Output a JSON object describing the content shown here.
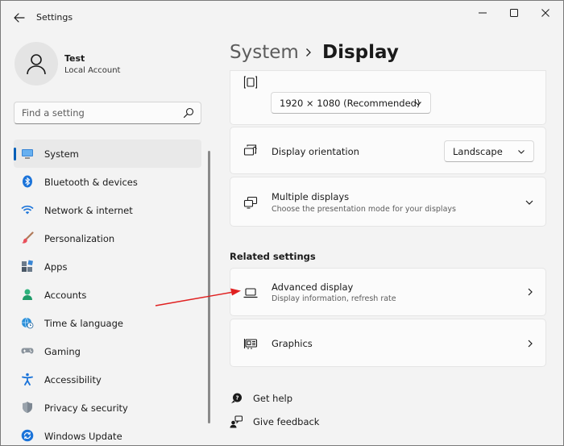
{
  "window": {
    "title": "Settings"
  },
  "user": {
    "name": "Test",
    "account_type": "Local Account"
  },
  "search": {
    "placeholder": "Find a setting"
  },
  "sidebar": {
    "items": [
      {
        "label": "System",
        "icon": "monitor-icon",
        "active": true
      },
      {
        "label": "Bluetooth & devices",
        "icon": "bluetooth-icon"
      },
      {
        "label": "Network & internet",
        "icon": "wifi-icon"
      },
      {
        "label": "Personalization",
        "icon": "brush-icon"
      },
      {
        "label": "Apps",
        "icon": "apps-icon"
      },
      {
        "label": "Accounts",
        "icon": "person-icon"
      },
      {
        "label": "Time & language",
        "icon": "globe-clock-icon"
      },
      {
        "label": "Gaming",
        "icon": "gamepad-icon"
      },
      {
        "label": "Accessibility",
        "icon": "accessibility-icon"
      },
      {
        "label": "Privacy & security",
        "icon": "shield-icon"
      },
      {
        "label": "Windows Update",
        "icon": "update-icon"
      }
    ]
  },
  "header": {
    "root": "System",
    "current": "Display"
  },
  "resolution": {
    "value": "1920 × 1080 (Recommended)"
  },
  "orientation": {
    "title": "Display orientation",
    "value": "Landscape"
  },
  "multiple": {
    "title": "Multiple displays",
    "subtitle": "Choose the presentation mode for your displays"
  },
  "related": {
    "heading": "Related settings",
    "advanced": {
      "title": "Advanced display",
      "subtitle": "Display information, refresh rate"
    },
    "graphics": {
      "title": "Graphics"
    }
  },
  "links": {
    "help": "Get help",
    "feedback": "Give feedback"
  },
  "colors": {
    "accent": "#005fb8",
    "annotation_arrow": "#e02020"
  }
}
